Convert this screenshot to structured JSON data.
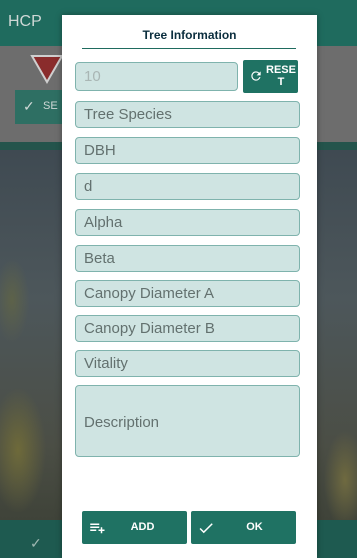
{
  "background_app": {
    "title": "HCP",
    "left_button_label": "SE"
  },
  "dialog": {
    "title": "Tree Information",
    "id_field_value": "10",
    "reset_label": "RESET",
    "fields": {
      "tree_species": "Tree Species",
      "dbh": "DBH",
      "d": "d",
      "alpha": "Alpha",
      "beta": "Beta",
      "canopy_diameter_a": "Canopy Diameter A",
      "canopy_diameter_b": "Canopy Diameter B",
      "vitality": "Vitality",
      "description": "Description"
    },
    "add_label": "ADD",
    "ok_label": "OK"
  },
  "colors": {
    "accent": "#1f7263",
    "field_bg": "#cfe4e2",
    "title_text": "#0b2e3e"
  },
  "icons": {
    "reset": "refresh-icon",
    "add": "playlist-add-icon",
    "ok": "check-icon"
  }
}
